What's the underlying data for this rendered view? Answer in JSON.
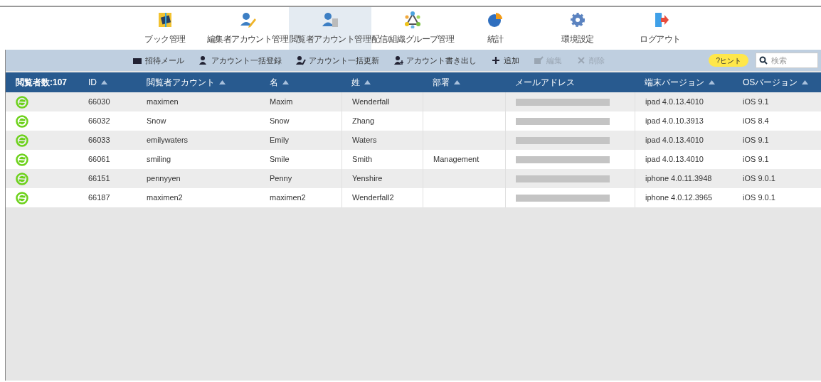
{
  "nav": [
    {
      "label": "ブック管理",
      "selected": false
    },
    {
      "label": "編集者アカウント管理",
      "selected": false
    },
    {
      "label": "閲覧者アカウント管理",
      "selected": true
    },
    {
      "label": "配信/組織グループ管理",
      "selected": false
    },
    {
      "label": "統計",
      "selected": false
    },
    {
      "label": "環境設定",
      "selected": false
    },
    {
      "label": "ログアウト",
      "selected": false
    }
  ],
  "toolbar": [
    {
      "label": "招待メール",
      "disabled": false
    },
    {
      "label": "アカウント一括登録",
      "disabled": false
    },
    {
      "label": "アカウント一括更新",
      "disabled": false
    },
    {
      "label": "アカウント書き出し",
      "disabled": false
    },
    {
      "label": "追加",
      "disabled": false
    },
    {
      "label": "編集",
      "disabled": true
    },
    {
      "label": "削除",
      "disabled": true
    }
  ],
  "hint": "?ヒント",
  "search": {
    "placeholder": "検索"
  },
  "table": {
    "columns": [
      {
        "label": "閲覧者数:107",
        "sortable": false
      },
      {
        "label": "ID",
        "sortable": true
      },
      {
        "label": "閲覧者アカウント",
        "sortable": true
      },
      {
        "label": "名",
        "sortable": true
      },
      {
        "label": "姓",
        "sortable": true
      },
      {
        "label": "部署",
        "sortable": true
      },
      {
        "label": "メールアドレス",
        "sortable": false
      },
      {
        "label": "端末バージョン",
        "sortable": true
      },
      {
        "label": "OSバージョン",
        "sortable": true
      }
    ],
    "rows": [
      {
        "id": "66030",
        "account": "maximen",
        "first": "Maxim",
        "last": "Wenderfall",
        "dept": "",
        "device": "ipad 4.0.13.4010",
        "os": "iOS 9.1"
      },
      {
        "id": "66032",
        "account": "Snow",
        "first": "Snow",
        "last": "Zhang",
        "dept": "",
        "device": "ipad 4.0.10.3913",
        "os": "iOS 8.4"
      },
      {
        "id": "66033",
        "account": "emilywaters",
        "first": "Emily",
        "last": "Waters",
        "dept": "",
        "device": "ipad 4.0.13.4010",
        "os": "iOS 9.1"
      },
      {
        "id": "66061",
        "account": "smiling",
        "first": "Smile",
        "last": "Smith",
        "dept": "Management",
        "device": "ipad 4.0.13.4010",
        "os": "iOS 9.1"
      },
      {
        "id": "66151",
        "account": "pennyyen",
        "first": "Penny",
        "last": "Yenshire",
        "dept": "",
        "device": "iphone 4.0.11.3948",
        "os": "iOS 9.0.1"
      },
      {
        "id": "66187",
        "account": "maximen2",
        "first": "maximen2",
        "last": "Wenderfall2",
        "dept": "",
        "device": "iphone 4.0.12.3965",
        "os": "iOS 9.0.1"
      }
    ]
  }
}
